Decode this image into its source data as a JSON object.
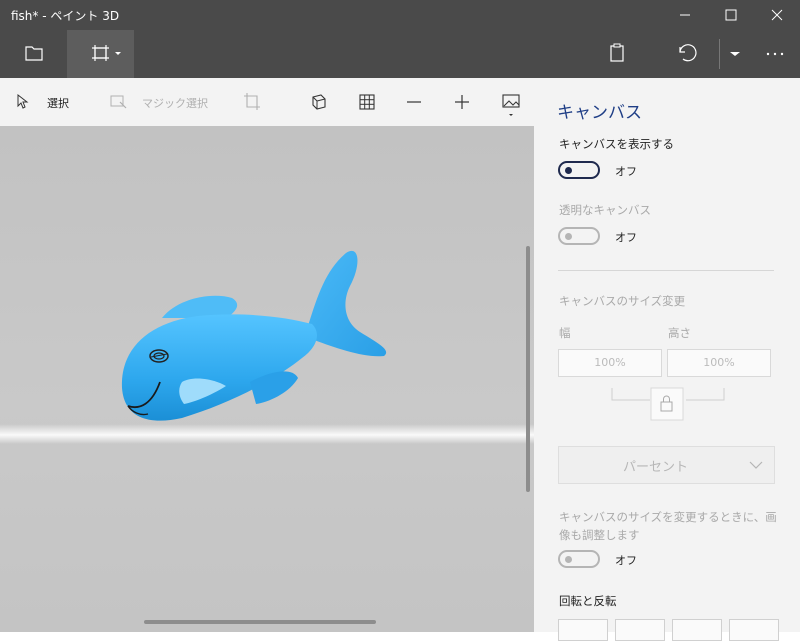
{
  "window": {
    "title": "fish* - ペイント 3D"
  },
  "toolbar": {
    "select_label": "選択",
    "magic_select_label": "マジック選択"
  },
  "panel": {
    "title": "キャンバス",
    "show_canvas": {
      "label": "キャンバスを表示する",
      "state": "オフ"
    },
    "transparent_canvas": {
      "label": "透明なキャンバス",
      "state": "オフ"
    },
    "resize": {
      "heading": "キャンバスのサイズ変更",
      "width_label": "幅",
      "height_label": "高さ",
      "width_value": "100%",
      "height_value": "100%",
      "unit_option": "パーセント"
    },
    "resize_image": {
      "label": "キャンバスのサイズを変更するときに、画像も調整します",
      "state": "オフ"
    },
    "rotate_flip_heading": "回転と反転"
  },
  "colors": {
    "accent": "#1f3e86",
    "title_bar": "#4a4a4a",
    "fish": "#2ea8ee"
  }
}
